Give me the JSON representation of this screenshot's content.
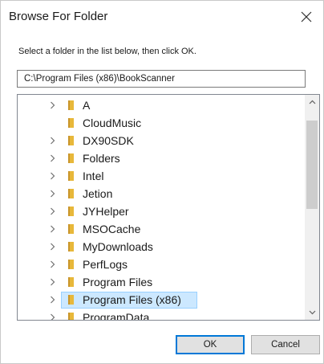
{
  "dialog": {
    "title": "Browse For Folder",
    "instruction": "Select a folder in the list below, then click OK.",
    "path": "C:\\Program Files (x86)\\BookScanner"
  },
  "tree": {
    "items": [
      {
        "label": "A",
        "has_children": true,
        "selected": false
      },
      {
        "label": "CloudMusic",
        "has_children": false,
        "selected": false
      },
      {
        "label": "DX90SDK",
        "has_children": true,
        "selected": false
      },
      {
        "label": "Folders",
        "has_children": true,
        "selected": false
      },
      {
        "label": "Intel",
        "has_children": true,
        "selected": false
      },
      {
        "label": "Jetion",
        "has_children": true,
        "selected": false
      },
      {
        "label": "JYHelper",
        "has_children": true,
        "selected": false
      },
      {
        "label": "MSOCache",
        "has_children": true,
        "selected": false
      },
      {
        "label": "MyDownloads",
        "has_children": true,
        "selected": false
      },
      {
        "label": "PerfLogs",
        "has_children": true,
        "selected": false
      },
      {
        "label": "Program Files",
        "has_children": true,
        "selected": false
      },
      {
        "label": "Program Files (x86)",
        "has_children": true,
        "selected": true
      },
      {
        "label": "ProgramData",
        "has_children": true,
        "selected": false
      }
    ]
  },
  "buttons": {
    "ok": "OK",
    "cancel": "Cancel"
  },
  "icons": {
    "close": "close-icon",
    "folder": "folder-icon",
    "expand": "chevron-right-icon",
    "scroll_up": "chevron-up-icon",
    "scroll_down": "chevron-down-icon"
  },
  "colors": {
    "selection_bg": "#cce8ff",
    "selection_border": "#99d1ff",
    "folder": "#e8b83a",
    "default_button_border": "#0078d7"
  }
}
